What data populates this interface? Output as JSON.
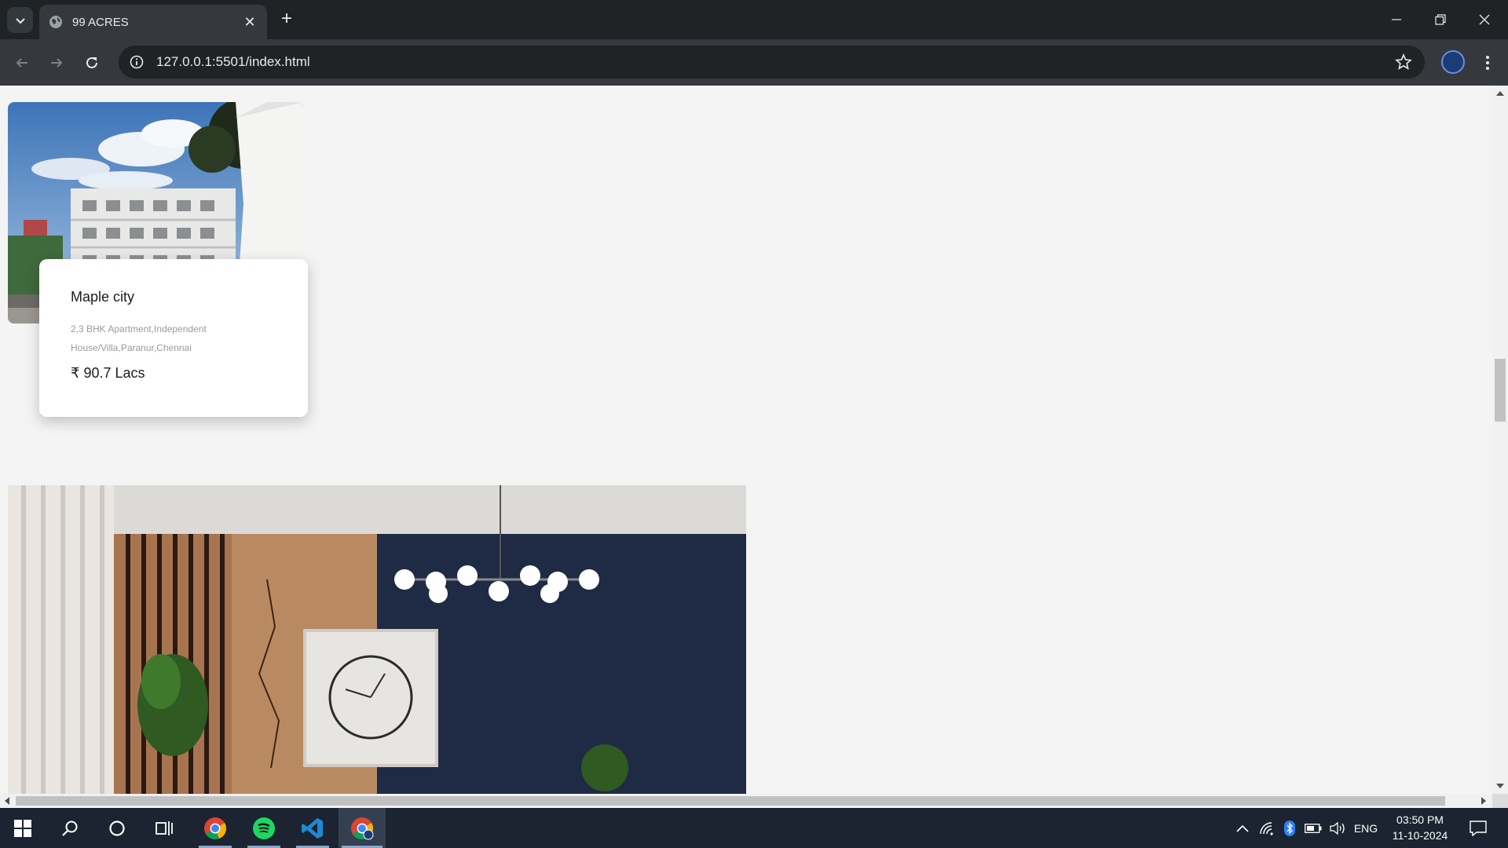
{
  "browser": {
    "tab_title": "99 ACRES",
    "url": "127.0.0.1:5501/index.html",
    "new_tab_label": "+"
  },
  "property": {
    "name": "Maple city",
    "description": "2,3 BHK Apartment,Independent House/Villa,Paranur,Chennai",
    "price": "₹ 90.7 Lacs"
  },
  "taskbar": {
    "apps": [
      "start-icon",
      "search-icon",
      "cortana-icon",
      "task-view-icon",
      "chrome-icon",
      "spotify-icon",
      "vscode-icon",
      "chrome-profile-icon"
    ],
    "language": "ENG",
    "time": "03:50 PM",
    "date": "11-10-2024"
  },
  "colors": {
    "page_background": "#f4f4f4",
    "browser_frame": "#1f2326",
    "toolbar": "#35393d",
    "taskbar": "#1b2430"
  }
}
